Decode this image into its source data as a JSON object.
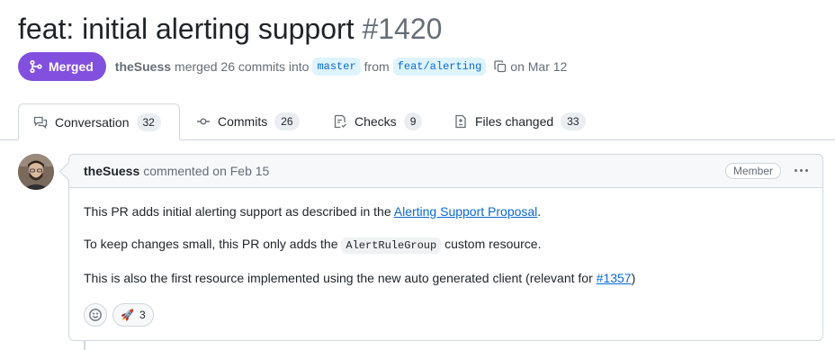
{
  "pr": {
    "title": "feat: initial alerting support",
    "number": "#1420",
    "state_label": "Merged",
    "author": "theSuess",
    "merged_text": "merged 26 commits into",
    "base_branch": "master",
    "from_text": "from",
    "head_branch": "feat/alerting",
    "date_text": "on Mar 12"
  },
  "tabs": [
    {
      "label": "Conversation",
      "count": "32",
      "icon": "comment-discussion-icon"
    },
    {
      "label": "Commits",
      "count": "26",
      "icon": "git-commit-icon"
    },
    {
      "label": "Checks",
      "count": "9",
      "icon": "checklist-icon"
    },
    {
      "label": "Files changed",
      "count": "33",
      "icon": "file-diff-icon"
    }
  ],
  "comment": {
    "author": "theSuess",
    "meta": "commented on Feb 15",
    "role_badge": "Member",
    "p1_prefix": "This PR adds initial alerting support as described in the ",
    "p1_link": "Alerting Support Proposal",
    "p1_suffix": ".",
    "p2_prefix": "To keep changes small, this PR only adds the ",
    "p2_code": "AlertRuleGroup",
    "p2_suffix": " custom resource.",
    "p3_prefix": "This is also the first resource implemented using the new auto generated client (relevant for ",
    "p3_link": "#1357",
    "p3_suffix": ")",
    "reactions": [
      {
        "emoji": "🚀",
        "count": "3"
      }
    ]
  },
  "colors": {
    "merged": "#8250df",
    "link": "#0969da",
    "branch_bg": "#ddf4ff"
  }
}
